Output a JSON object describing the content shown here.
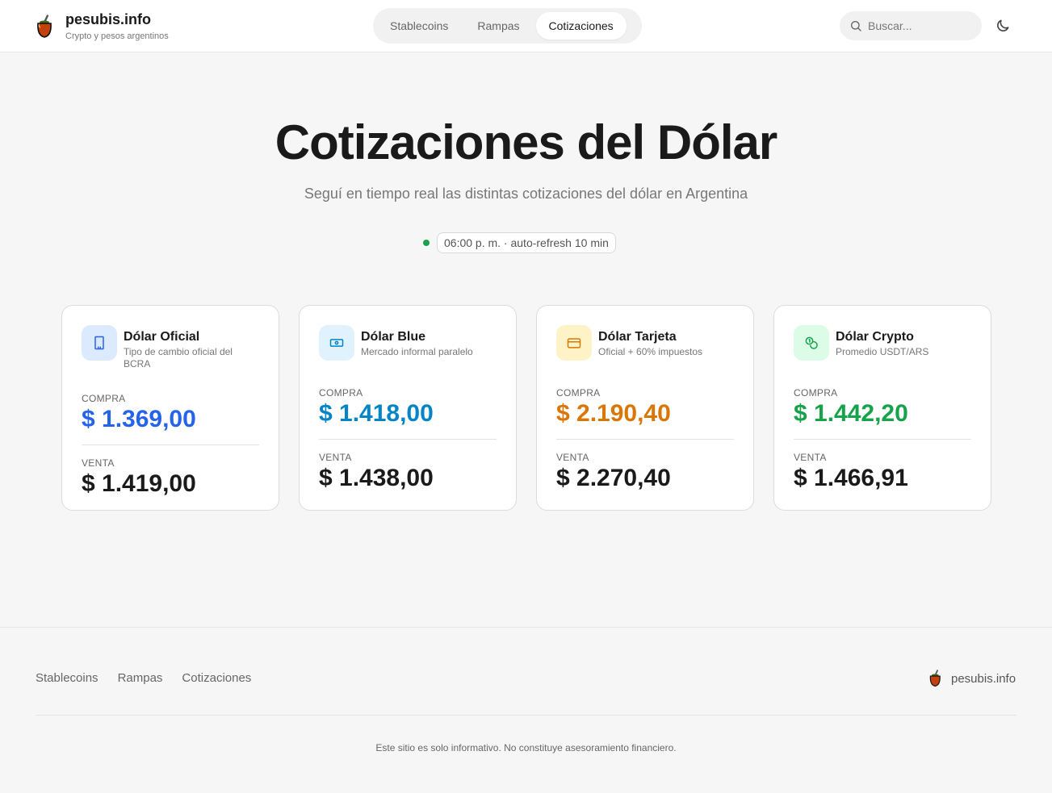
{
  "brand": {
    "name": "pesubis.info",
    "tagline": "Crypto y pesos argentinos"
  },
  "nav": {
    "items": [
      {
        "label": "Stablecoins",
        "active": false
      },
      {
        "label": "Rampas",
        "active": false
      },
      {
        "label": "Cotizaciones",
        "active": true
      }
    ]
  },
  "search": {
    "placeholder": "Buscar..."
  },
  "hero": {
    "title": "Cotizaciones del Dólar",
    "subtitle": "Seguí en tiempo real las distintas cotizaciones del dólar en Argentina",
    "status": "06:00 p. m. · auto-refresh 10 min"
  },
  "labels": {
    "buy": "COMPRA",
    "sell": "VENTA"
  },
  "cards": [
    {
      "title": "Dólar Oficial",
      "desc": "Tipo de cambio oficial del BCRA",
      "buy": "$ 1.369,00",
      "sell": "$ 1.419,00",
      "icon": "building-icon",
      "accent": "#2563eb",
      "iconBg": "#dbeafe"
    },
    {
      "title": "Dólar Blue",
      "desc": "Mercado informal paralelo",
      "buy": "$ 1.418,00",
      "sell": "$ 1.438,00",
      "icon": "banknote-icon",
      "accent": "#0284c7",
      "iconBg": "#e0f2fe"
    },
    {
      "title": "Dólar Tarjeta",
      "desc": "Oficial + 60% impuestos",
      "buy": "$ 2.190,40",
      "sell": "$ 2.270,40",
      "icon": "credit-card-icon",
      "accent": "#d97706",
      "iconBg": "#fef3c7"
    },
    {
      "title": "Dólar Crypto",
      "desc": "Promedio USDT/ARS",
      "buy": "$ 1.442,20",
      "sell": "$ 1.466,91",
      "icon": "coins-icon",
      "accent": "#16a34a",
      "iconBg": "#dcfce7"
    }
  ],
  "footer": {
    "links": [
      "Stablecoins",
      "Rampas",
      "Cotizaciones"
    ],
    "brand": "pesubis.info",
    "note": "Este sitio es solo informativo. No constituye asesoramiento financiero."
  }
}
